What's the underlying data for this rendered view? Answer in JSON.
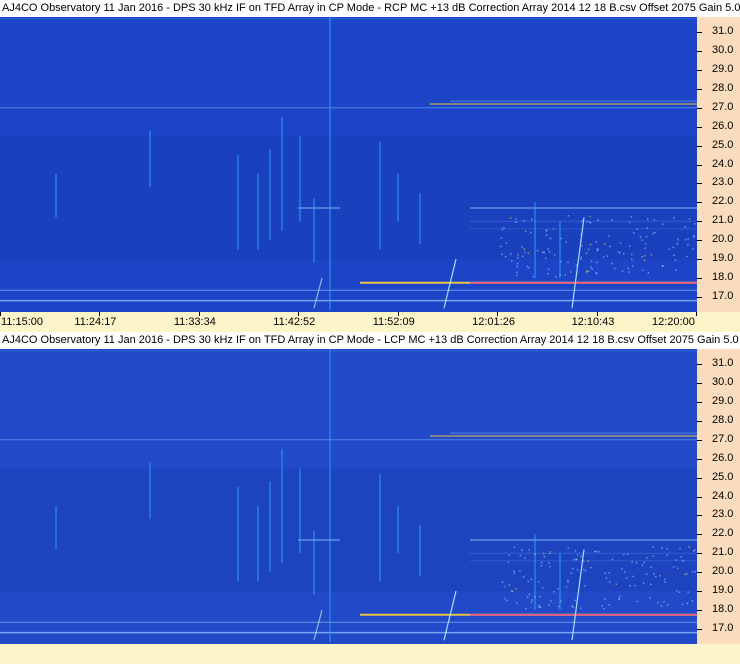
{
  "chart_data": [
    {
      "type": "heatmap",
      "title": "AJ4CO Observatory 11 Jan 2016 - DPS 30 kHz IF on TFD Array in CP Mode - RCP  MC +13 dB  Correction Array 2014 12 18 B.csv  Offset 2075  Gain 5.0",
      "x_ticks": [
        "11:15:00",
        "11:24:17",
        "11:33:34",
        "11:42:52",
        "11:52:09",
        "12:01:26",
        "12:10:43",
        "12:20:00"
      ],
      "y_ticks": [
        31.0,
        30.0,
        29.0,
        28.0,
        27.0,
        26.0,
        25.0,
        24.0,
        23.0,
        22.0,
        21.0,
        20.0,
        19.0,
        18.0,
        17.0
      ],
      "y_tick_labels": [
        "31.0",
        "30.0",
        "29.0",
        "28.0",
        "27.0",
        "26.0",
        "25.0",
        "24.0",
        "23.0",
        "22.0",
        "21.0",
        "20.0",
        "19.0",
        "18.0",
        "17.0"
      ],
      "ylim": [
        16.2,
        31.8
      ],
      "colors": {
        "background": "#1d44c6",
        "signal": "#27a9ff",
        "hot": "#ffd23a",
        "peak": "#ff3a8c"
      }
    },
    {
      "type": "heatmap",
      "title": "AJ4CO Observatory 11 Jan 2016 - DPS 30 kHz IF on TFD Array in CP Mode - LCP  MC +13 dB  Correction Array 2014 12 18 B.csv  Offset 2075  Gain 5.0",
      "x_ticks": [],
      "y_ticks": [
        31.0,
        30.0,
        29.0,
        28.0,
        27.0,
        26.0,
        25.0,
        24.0,
        23.0,
        22.0,
        21.0,
        20.0,
        19.0,
        18.0,
        17.0
      ],
      "y_tick_labels": [
        "31.0",
        "30.0",
        "29.0",
        "28.0",
        "27.0",
        "26.0",
        "25.0",
        "24.0",
        "23.0",
        "22.0",
        "21.0",
        "20.0",
        "19.0",
        "18.0",
        "17.0"
      ],
      "ylim": [
        16.2,
        31.8
      ],
      "colors": {
        "background": "#2149c8",
        "signal": "#27a9ff",
        "hot": "#ffd23a",
        "peak": "#ff3a8c"
      }
    }
  ]
}
